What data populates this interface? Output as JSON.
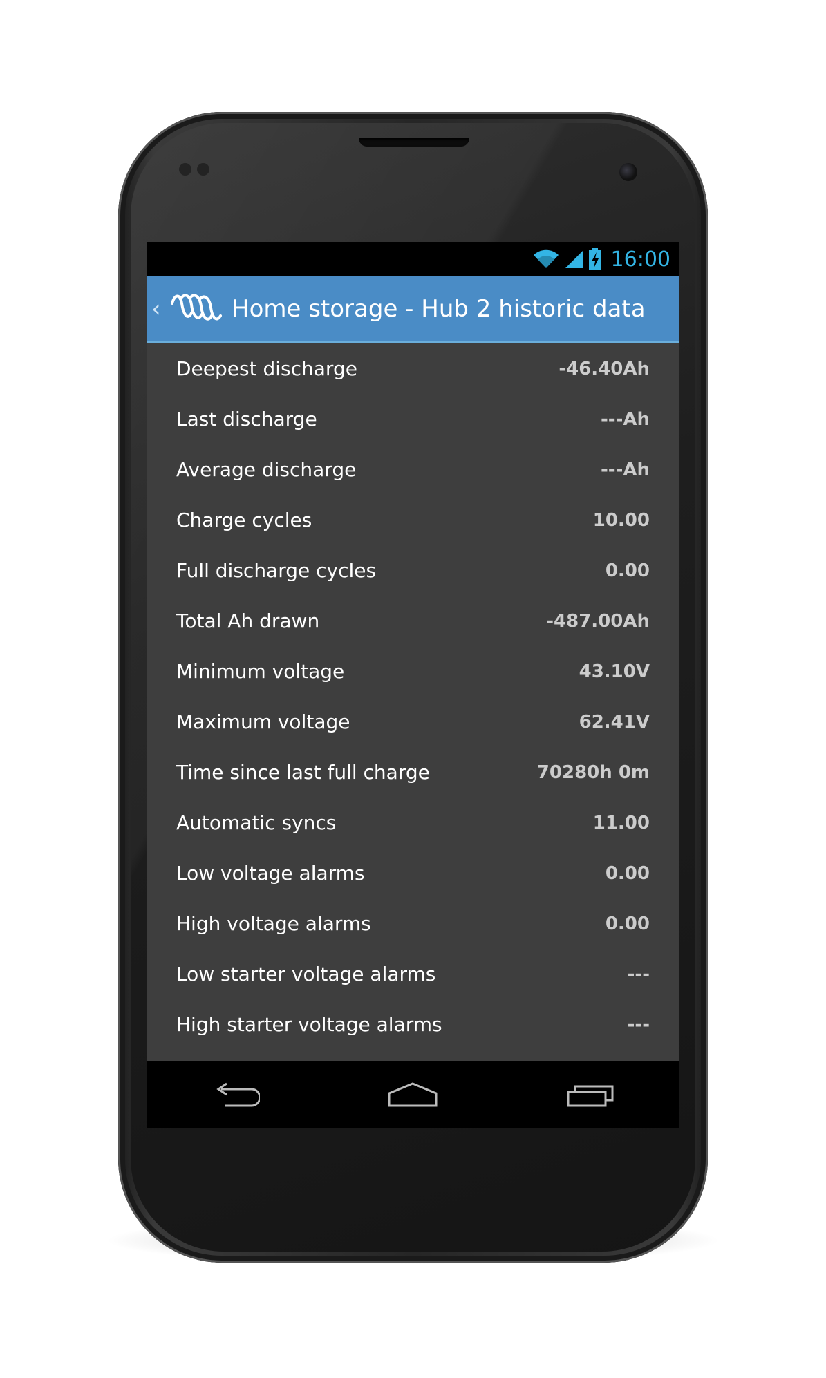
{
  "status_bar": {
    "time": "16:00",
    "icons": [
      "wifi-icon",
      "signal-icon",
      "battery-charging-icon"
    ],
    "accent_color": "#33b5e5"
  },
  "action_bar": {
    "title": "Home storage - Hub 2 historic data",
    "logo": "victron-logo-icon",
    "up_icon": "chevron-left-icon",
    "background_color": "#4a8cc6"
  },
  "rows": [
    {
      "label": "Deepest discharge",
      "value": "-46.40Ah"
    },
    {
      "label": "Last discharge",
      "value": "---Ah"
    },
    {
      "label": "Average discharge",
      "value": "---Ah"
    },
    {
      "label": "Charge cycles",
      "value": "10.00"
    },
    {
      "label": "Full discharge cycles",
      "value": "0.00"
    },
    {
      "label": "Total Ah drawn",
      "value": "-487.00Ah"
    },
    {
      "label": "Minimum voltage",
      "value": "43.10V"
    },
    {
      "label": "Maximum voltage",
      "value": "62.41V"
    },
    {
      "label": "Time since last full charge",
      "value": "70280h 0m"
    },
    {
      "label": "Automatic syncs",
      "value": "11.00"
    },
    {
      "label": "Low voltage alarms",
      "value": "0.00"
    },
    {
      "label": "High voltage alarms",
      "value": "0.00"
    },
    {
      "label": "Low starter voltage alarms",
      "value": "---"
    },
    {
      "label": "High starter voltage alarms",
      "value": "---"
    }
  ],
  "nav_bar": {
    "buttons": [
      "back-icon",
      "home-icon",
      "recent-apps-icon"
    ]
  }
}
